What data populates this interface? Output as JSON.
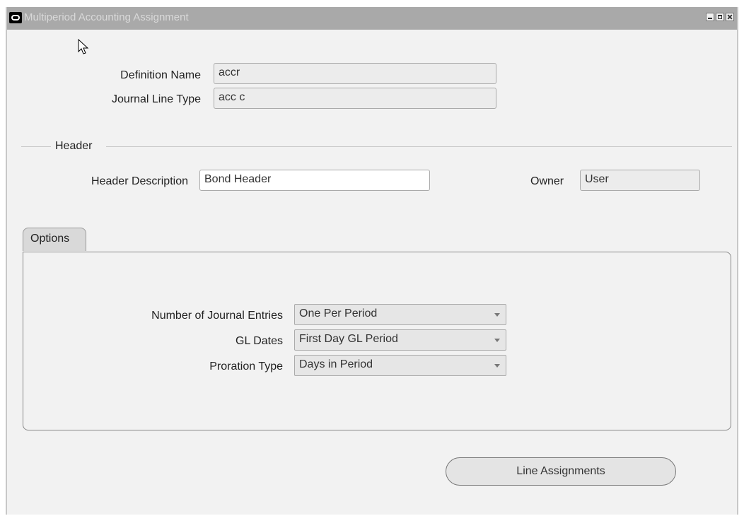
{
  "window": {
    "title": "Multiperiod Accounting Assignment"
  },
  "definition": {
    "name_label": "Definition Name",
    "name_value": "accr",
    "journal_line_type_label": "Journal Line Type",
    "journal_line_type_value": "acc c"
  },
  "header_section": {
    "title": "Header",
    "description_label": "Header Description",
    "description_value": "Bond Header",
    "owner_label": "Owner",
    "owner_value": "User"
  },
  "tabs": [
    {
      "label": "Options",
      "active": true
    }
  ],
  "options": {
    "journal_entries_label": "Number of Journal Entries",
    "journal_entries_value": "One Per Period",
    "gl_dates_label": "GL Dates",
    "gl_dates_value": "First Day GL Period",
    "proration_type_label": "Proration Type",
    "proration_type_value": "Days in Period"
  },
  "actions": {
    "line_assignments_label": "Line Assignments"
  },
  "colors": {
    "titlebar": "#a9a9a9",
    "background": "#f2f2f2"
  }
}
